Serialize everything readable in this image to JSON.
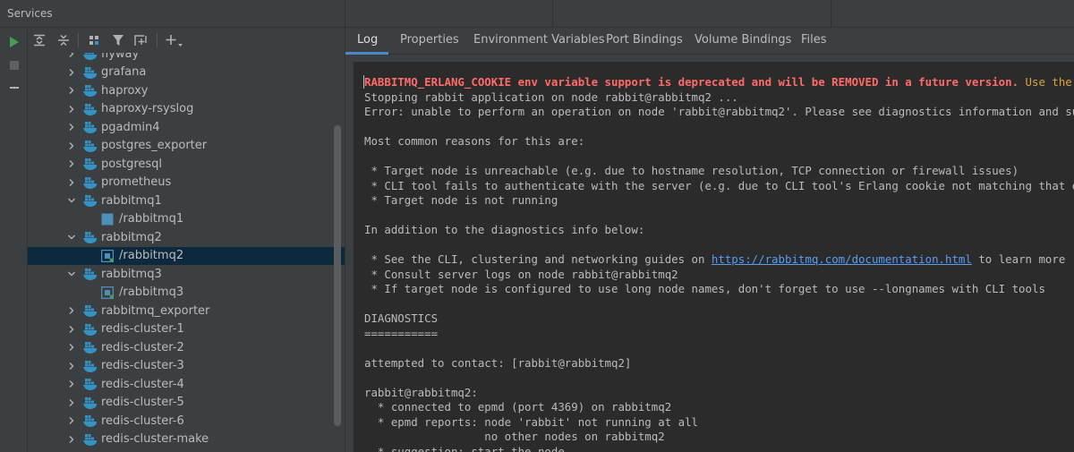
{
  "window": {
    "title": "Services"
  },
  "colors": {
    "accent": "#4a88c7",
    "docker_blue": "#3592c4",
    "error": "#ff6b68",
    "warning": "#d9a343",
    "link": "#589df6",
    "run_green": "#499c54"
  },
  "toolbar": {
    "buttons": [
      "expand-all-icon",
      "collapse-all-icon",
      "group-by-icon",
      "filter-icon",
      "new-tab-icon",
      "add-icon"
    ]
  },
  "gutter": {
    "buttons": [
      "run-icon",
      "stop-icon",
      "minus-icon"
    ]
  },
  "tree": {
    "items": [
      {
        "label": "flyway",
        "level": 0,
        "expanded": false,
        "icon": "docker-icon"
      },
      {
        "label": "grafana",
        "level": 0,
        "expanded": false,
        "icon": "docker-icon"
      },
      {
        "label": "haproxy",
        "level": 0,
        "expanded": false,
        "icon": "docker-icon"
      },
      {
        "label": "haproxy-rsyslog",
        "level": 0,
        "expanded": false,
        "icon": "docker-icon"
      },
      {
        "label": "pgadmin4",
        "level": 0,
        "expanded": false,
        "icon": "docker-icon"
      },
      {
        "label": "postgres_exporter",
        "level": 0,
        "expanded": false,
        "icon": "docker-icon"
      },
      {
        "label": "postgresql",
        "level": 0,
        "expanded": false,
        "icon": "docker-icon"
      },
      {
        "label": "prometheus",
        "level": 0,
        "expanded": false,
        "icon": "docker-icon"
      },
      {
        "label": "rabbitmq1",
        "level": 0,
        "expanded": true,
        "icon": "docker-icon"
      },
      {
        "label": "/rabbitmq1",
        "level": 1,
        "icon": "container-stopped-icon"
      },
      {
        "label": "rabbitmq2",
        "level": 0,
        "expanded": true,
        "icon": "docker-icon"
      },
      {
        "label": "/rabbitmq2",
        "level": 1,
        "icon": "container-running-icon",
        "selected": true
      },
      {
        "label": "rabbitmq3",
        "level": 0,
        "expanded": true,
        "icon": "docker-icon"
      },
      {
        "label": "/rabbitmq3",
        "level": 1,
        "icon": "container-running-icon"
      },
      {
        "label": "rabbitmq_exporter",
        "level": 0,
        "expanded": false,
        "icon": "docker-icon"
      },
      {
        "label": "redis-cluster-1",
        "level": 0,
        "expanded": false,
        "icon": "docker-icon"
      },
      {
        "label": "redis-cluster-2",
        "level": 0,
        "expanded": false,
        "icon": "docker-icon"
      },
      {
        "label": "redis-cluster-3",
        "level": 0,
        "expanded": false,
        "icon": "docker-icon"
      },
      {
        "label": "redis-cluster-4",
        "level": 0,
        "expanded": false,
        "icon": "docker-icon"
      },
      {
        "label": "redis-cluster-5",
        "level": 0,
        "expanded": false,
        "icon": "docker-icon"
      },
      {
        "label": "redis-cluster-6",
        "level": 0,
        "expanded": false,
        "icon": "docker-icon"
      },
      {
        "label": "redis-cluster-make",
        "level": 0,
        "expanded": false,
        "icon": "docker-icon"
      }
    ]
  },
  "tabs": [
    {
      "label": "Log",
      "active": true
    },
    {
      "label": "Properties"
    },
    {
      "label": "Environment Variables"
    },
    {
      "label": "Port Bindings"
    },
    {
      "label": "Volume Bindings"
    },
    {
      "label": "Files"
    }
  ],
  "log": {
    "line1_error": "RABBITMQ_ERLANG_COOKIE env variable support is deprecated and will be REMOVED in a future version.",
    "line1_warn": " Use the",
    "line2": "Stopping rabbit application on node rabbit@rabbitmq2 ...",
    "line3": "Error: unable to perform an operation on node 'rabbit@rabbitmq2'. Please see diagnostics information and su",
    "line5": "Most common reasons for this are:",
    "line7": " * Target node is unreachable (e.g. due to hostname resolution, TCP connection or firewall issues)",
    "line8": " * CLI tool fails to authenticate with the server (e.g. due to CLI tool's Erlang cookie not matching that o",
    "line9": " * Target node is not running",
    "line11": "In addition to the diagnostics info below:",
    "line13_pre": " * See the CLI, clustering and networking guides on ",
    "line13_link": "https://rabbitmq.com/documentation.html",
    "line13_post": " to learn more",
    "line14": " * Consult server logs on node rabbit@rabbitmq2",
    "line15": " * If target node is configured to use long node names, don't forget to use --longnames with CLI tools",
    "line17": "DIAGNOSTICS",
    "line18": "===========",
    "line20": "attempted to contact: [rabbit@rabbitmq2]",
    "line22": "rabbit@rabbitmq2:",
    "line23": "  * connected to epmd (port 4369) on rabbitmq2",
    "line24": "  * epmd reports: node 'rabbit' not running at all",
    "line25": "                  no other nodes on rabbitmq2",
    "line26": "  * suggestion: start the node"
  }
}
